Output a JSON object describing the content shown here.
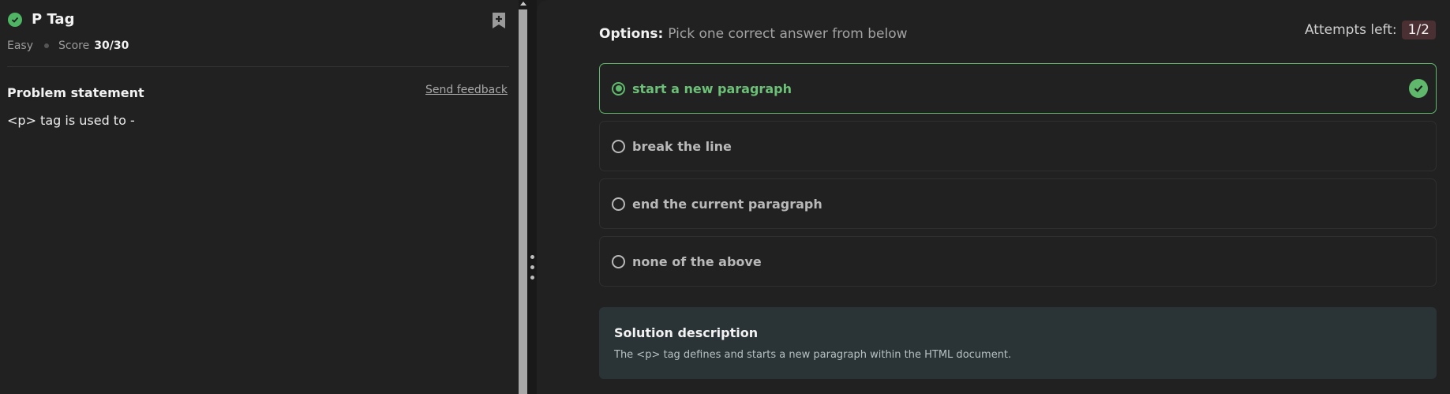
{
  "problem": {
    "title": "P Tag",
    "difficulty": "Easy",
    "score_label": "Score",
    "score_value": "30/30",
    "statement_heading": "Problem statement",
    "feedback_link": "Send feedback",
    "statement": "<p> tag is used to -"
  },
  "options_panel": {
    "heading": "Options:",
    "subheading": "Pick one correct answer from below",
    "attempts_label": "Attempts left:",
    "attempts_value": "1/2",
    "options": [
      {
        "label": "start a new paragraph",
        "state": "selected-correct"
      },
      {
        "label": "break the line",
        "state": "unselected"
      },
      {
        "label": "end the current paragraph",
        "state": "unselected"
      },
      {
        "label": "none of the above",
        "state": "unselected"
      }
    ]
  },
  "solution": {
    "title": "Solution description",
    "text": "The <p> tag defines and starts a new paragraph within the HTML document."
  },
  "icons": {
    "status": "check-circle-icon",
    "bookmark": "bookmark-add-icon",
    "grip": "drag-handle-icon",
    "correct": "check-circle-icon"
  },
  "colors": {
    "accent_green": "#5fb86c",
    "attempts_badge": "#4a2f33",
    "solution_bg": "#2a3336"
  }
}
